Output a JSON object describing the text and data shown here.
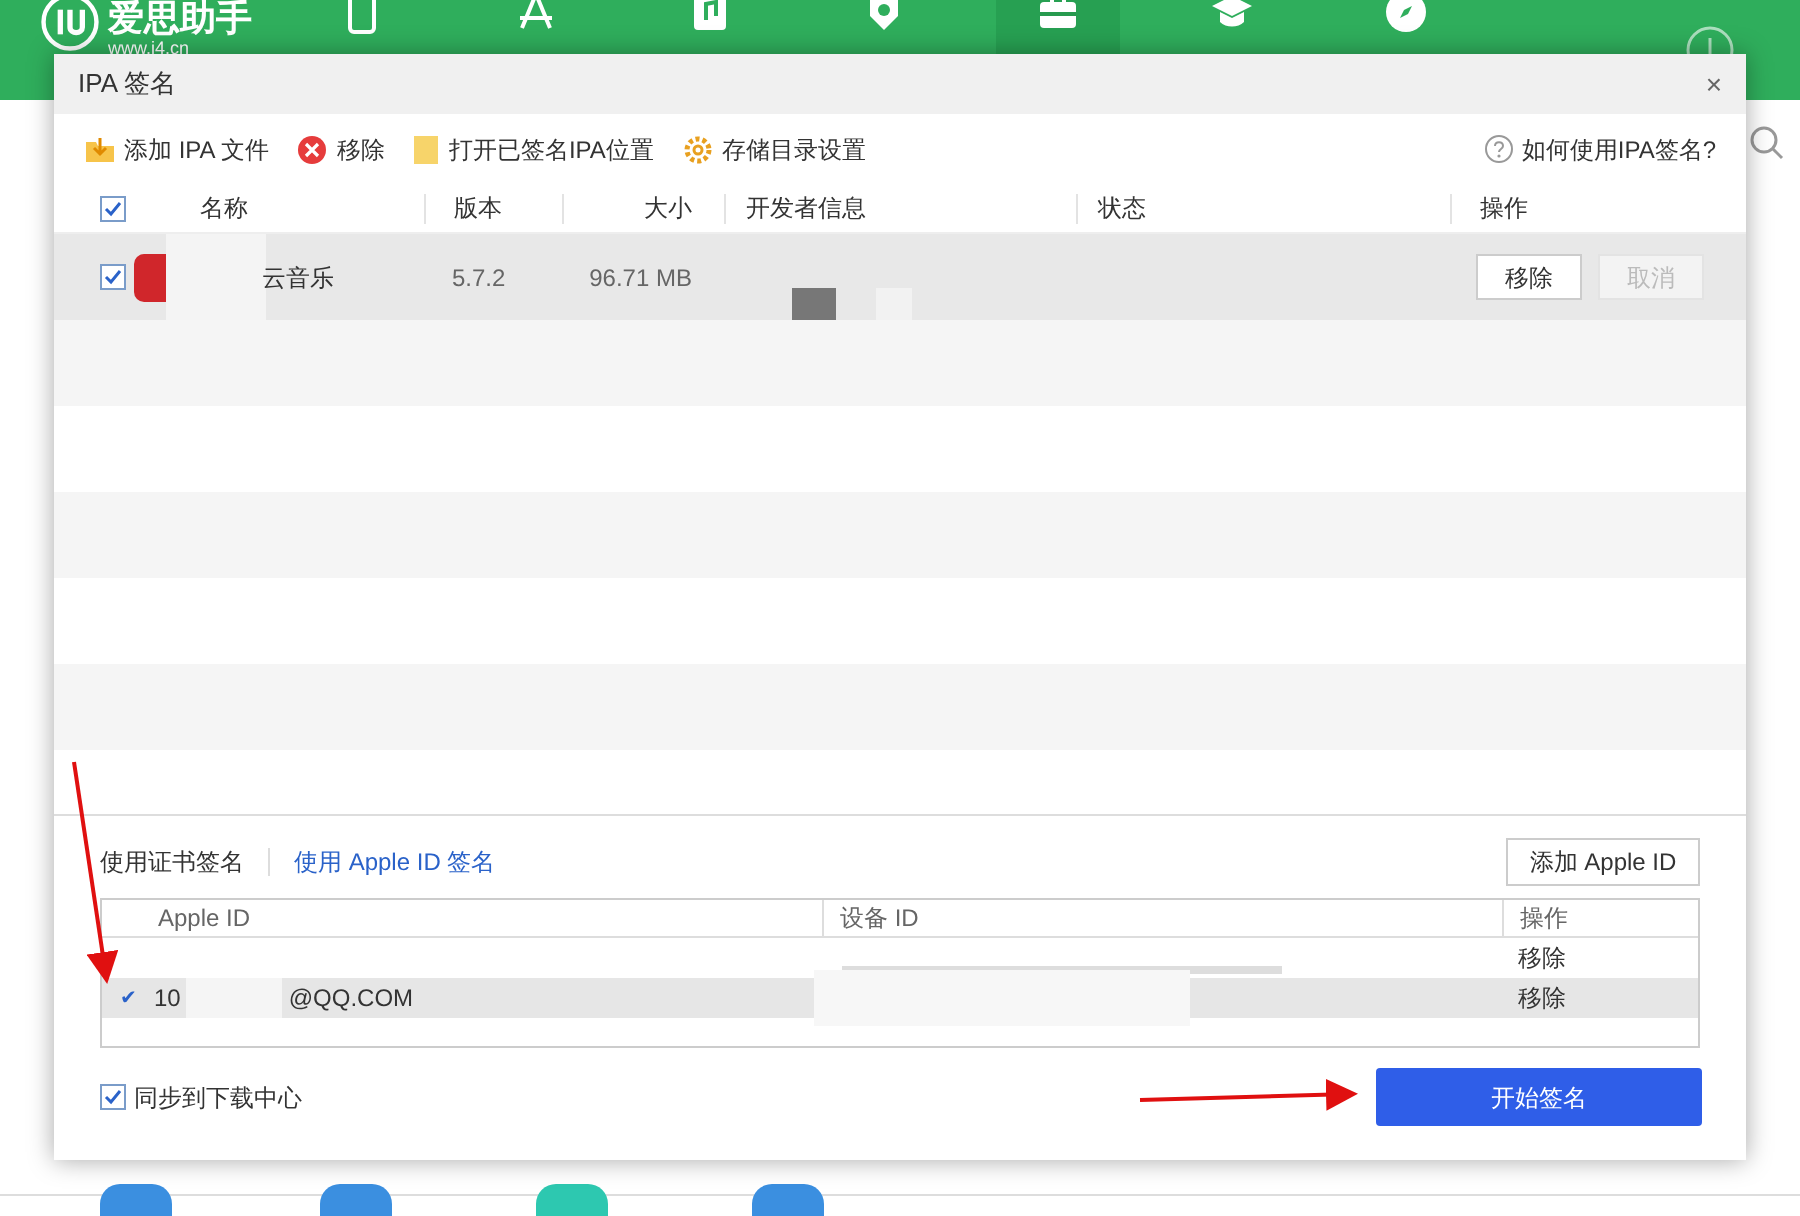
{
  "app": {
    "logo_text": "爱思助手",
    "url": "www.i4.cn",
    "nav": [
      {
        "selected": false
      },
      {
        "selected": false
      },
      {
        "selected": false
      },
      {
        "selected": false
      },
      {
        "selected": true
      },
      {
        "selected": false
      },
      {
        "selected": false
      }
    ]
  },
  "dialog": {
    "title": "IPA 签名",
    "close": "×",
    "toolbar": [
      {
        "kind": "add",
        "label": "添加 IPA 文件"
      },
      {
        "kind": "remove",
        "label": "移除"
      },
      {
        "kind": "folder",
        "label": "打开已签名IPA位置"
      },
      {
        "kind": "settings",
        "label": "存储目录设置"
      }
    ],
    "help": "如何使用IPA签名?",
    "header_checked": true,
    "columns": [
      "名称",
      "版本",
      "大小",
      "开发者信息",
      "状态",
      "操作"
    ],
    "rows": [
      {
        "selected": true,
        "checked": true,
        "name": "云音乐",
        "version": "5.7.2",
        "size": "96.71 MB",
        "buttons": [
          {
            "label": "移除",
            "disabled": false
          },
          {
            "label": "取消",
            "disabled": true
          }
        ]
      }
    ],
    "sign_tabs": [
      {
        "label": "使用证书签名",
        "selected": false
      },
      {
        "label": "使用 Apple ID 签名",
        "selected": true
      }
    ],
    "add_apple_id": "添加 Apple ID",
    "id_columns": [
      "Apple ID",
      "设备 ID",
      "操作"
    ],
    "id_rows": [
      {
        "selected": false,
        "action": "移除"
      },
      {
        "selected": true,
        "check": "✔",
        "id_start": "10",
        "id_end": "@QQ.COM",
        "action": "移除"
      }
    ],
    "sync": {
      "label": "同步到下载中心",
      "checked": true
    },
    "start": "开始签名"
  }
}
